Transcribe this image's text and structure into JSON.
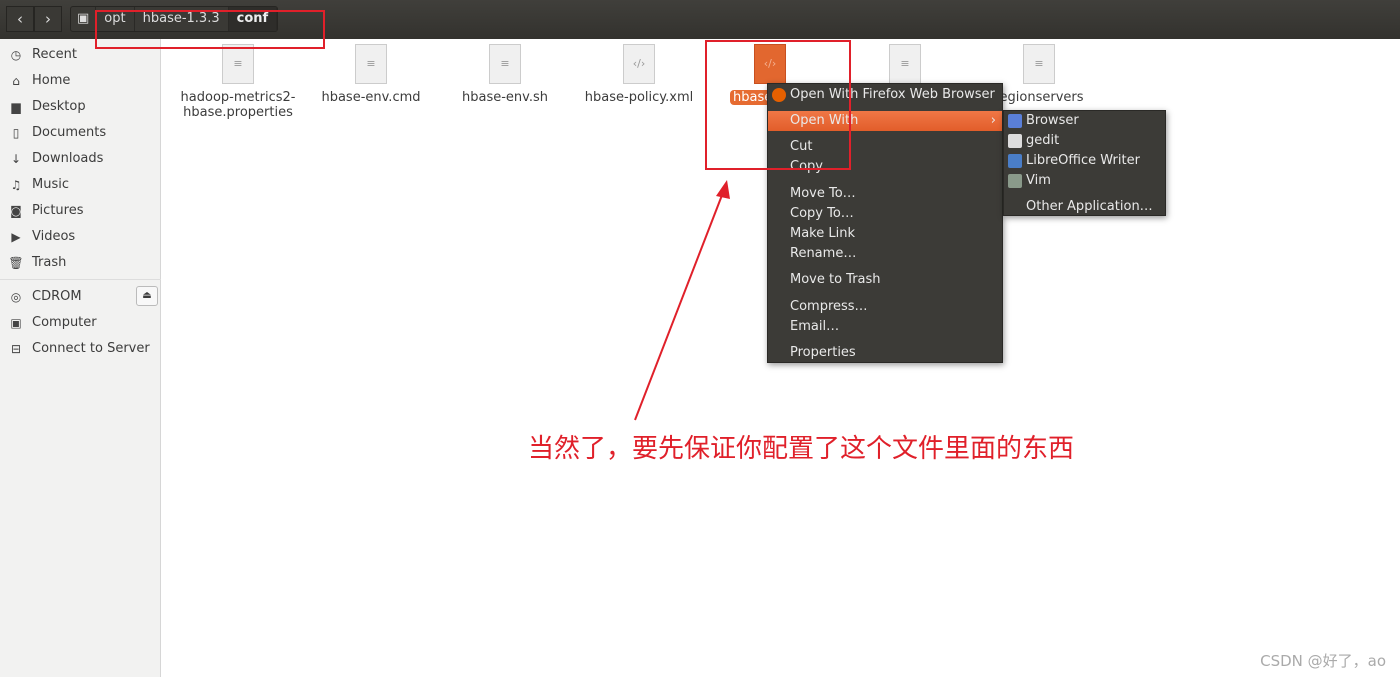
{
  "toolbar": {
    "back_icon": "chevron-left",
    "forward_icon": "chevron-right",
    "breadcrumbs": [
      "opt",
      "hbase-1.3.3",
      "conf"
    ]
  },
  "sidebar": {
    "items": [
      {
        "label": "Recent",
        "icon": "clock"
      },
      {
        "label": "Home",
        "icon": "home"
      },
      {
        "label": "Desktop",
        "icon": "folder"
      },
      {
        "label": "Documents",
        "icon": "document"
      },
      {
        "label": "Downloads",
        "icon": "download"
      },
      {
        "label": "Music",
        "icon": "music"
      },
      {
        "label": "Pictures",
        "icon": "camera"
      },
      {
        "label": "Videos",
        "icon": "video"
      },
      {
        "label": "Trash",
        "icon": "trash"
      }
    ],
    "devices": [
      {
        "label": "CDROM",
        "icon": "disc"
      },
      {
        "label": "Computer",
        "icon": "computer"
      },
      {
        "label": "Connect to Server",
        "icon": "server"
      }
    ]
  },
  "files": [
    {
      "name": "hadoop-metrics2-hbase.properties",
      "line1": "hadoop-metrics2-",
      "line2": "hbase.properties"
    },
    {
      "name": "hbase-env.cmd"
    },
    {
      "name": "hbase-env.sh"
    },
    {
      "name": "hbase-policy.xml"
    },
    {
      "name": "hbase-"
    },
    {
      "name": ""
    },
    {
      "name": "regionservers"
    }
  ],
  "context_menu": {
    "items": [
      "Open With Firefox Web Browser",
      "Open With",
      "Cut",
      "Copy",
      "Move To…",
      "Copy To…",
      "Make Link",
      "Rename…",
      "Move to Trash",
      "Compress…",
      "Email…",
      "Properties"
    ]
  },
  "submenu": {
    "items": [
      "Browser",
      "gedit",
      "LibreOffice Writer",
      "Vim",
      "Other Application…"
    ]
  },
  "annotation": "当然了，要先保证你配置了这个文件里面的东西",
  "watermark": "CSDN @好了，ao",
  "colors": {
    "accent": "#e66b31",
    "annotation": "#e0202a"
  }
}
